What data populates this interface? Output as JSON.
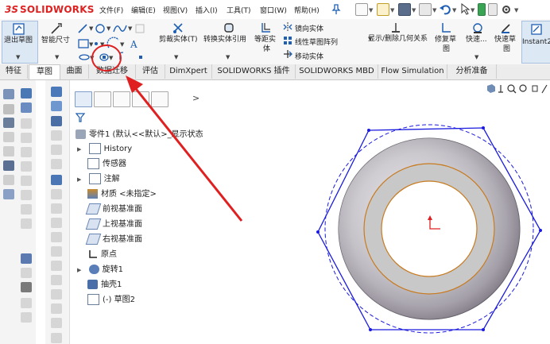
{
  "app": {
    "brand": "SOLIDWORKS",
    "brand_prefix": "3S"
  },
  "menu": [
    "文件(F)",
    "编辑(E)",
    "视图(V)",
    "插入(I)",
    "工具(T)",
    "窗口(W)",
    "帮助(H)"
  ],
  "ribbon": {
    "exit_sketch": "退出草图",
    "smart_dimension": "智能尺寸",
    "trim": "剪裁实体(T)",
    "convert": "转换实体引用",
    "offset": "等距实",
    "offset2": "体",
    "mirror": "镜向实体",
    "linear_pattern": "线性草图阵列",
    "move": "移动实体",
    "display_relations": "显示/删除几何关系",
    "repair": "修复草",
    "repair2": "图",
    "quick": "快速...",
    "quick_snap": "快速草",
    "quick_snap2": "图",
    "instant2d": "Instant2"
  },
  "tabs": [
    "特征",
    "草图",
    "曲面",
    "数据迁移",
    "评估",
    "DimXpert",
    "SOLIDWORKS 插件",
    "SOLIDWORKS MBD",
    "Flow Simulation",
    "分析准备"
  ],
  "active_tab": "草图",
  "featuremanager": {
    "more_arrow": ">",
    "root": "零件1  (默认<<默认>_显示状态",
    "items": [
      {
        "label": "History",
        "expand": true
      },
      {
        "label": "传感器",
        "expand": false
      },
      {
        "label": "注解",
        "expand": true
      },
      {
        "label": "材质 <未指定>",
        "expand": false
      },
      {
        "label": "前视基准面",
        "expand": false
      },
      {
        "label": "上视基准面",
        "expand": false
      },
      {
        "label": "右视基准面",
        "expand": false
      },
      {
        "label": "原点",
        "expand": false
      },
      {
        "label": "旋转1",
        "expand": true
      },
      {
        "label": "抽壳1",
        "expand": false
      },
      {
        "label": "(-) 草图2",
        "expand": false
      }
    ]
  },
  "colors": {
    "accent": "#1e5fb3",
    "brand_red": "#d22222",
    "annotation_red": "#e02020",
    "sketch_blue": "#1a1adf",
    "edge_orange": "#c87a1e"
  }
}
